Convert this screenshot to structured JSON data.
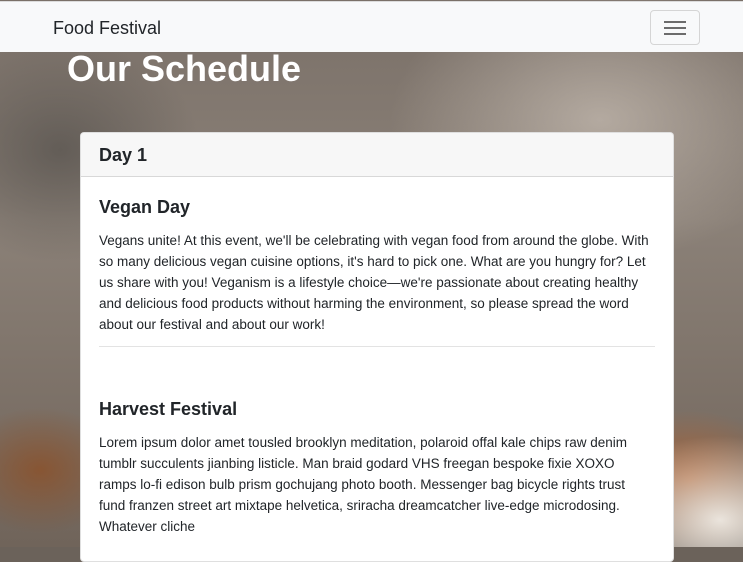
{
  "navbar": {
    "brand": "Food Festival",
    "menu_icon": "hamburger-menu-icon"
  },
  "page": {
    "title": "Our Schedule"
  },
  "schedule": {
    "day_label": "Day 1",
    "events": [
      {
        "title": "Vegan Day",
        "description": "Vegans unite! At this event, we'll be celebrating with vegan food from around the globe. With so many delicious vegan cuisine options, it's hard to pick one. What are you hungry for? Let us share with you! Veganism is a lifestyle choice—we're passionate about creating healthy and delicious food products without harming the environment, so please spread the word about our festival and about our work!"
      },
      {
        "title": "Harvest Festival",
        "description": "Lorem ipsum dolor amet tousled brooklyn meditation, polaroid offal kale chips raw denim tumblr succulents jianbing listicle. Man braid godard VHS freegan bespoke fixie XOXO ramps lo-fi edison bulb prism gochujang photo booth. Messenger bag bicycle rights trust fund franzen street art mixtape helvetica, sriracha dreamcatcher live-edge microdosing. Whatever cliche"
      }
    ]
  }
}
